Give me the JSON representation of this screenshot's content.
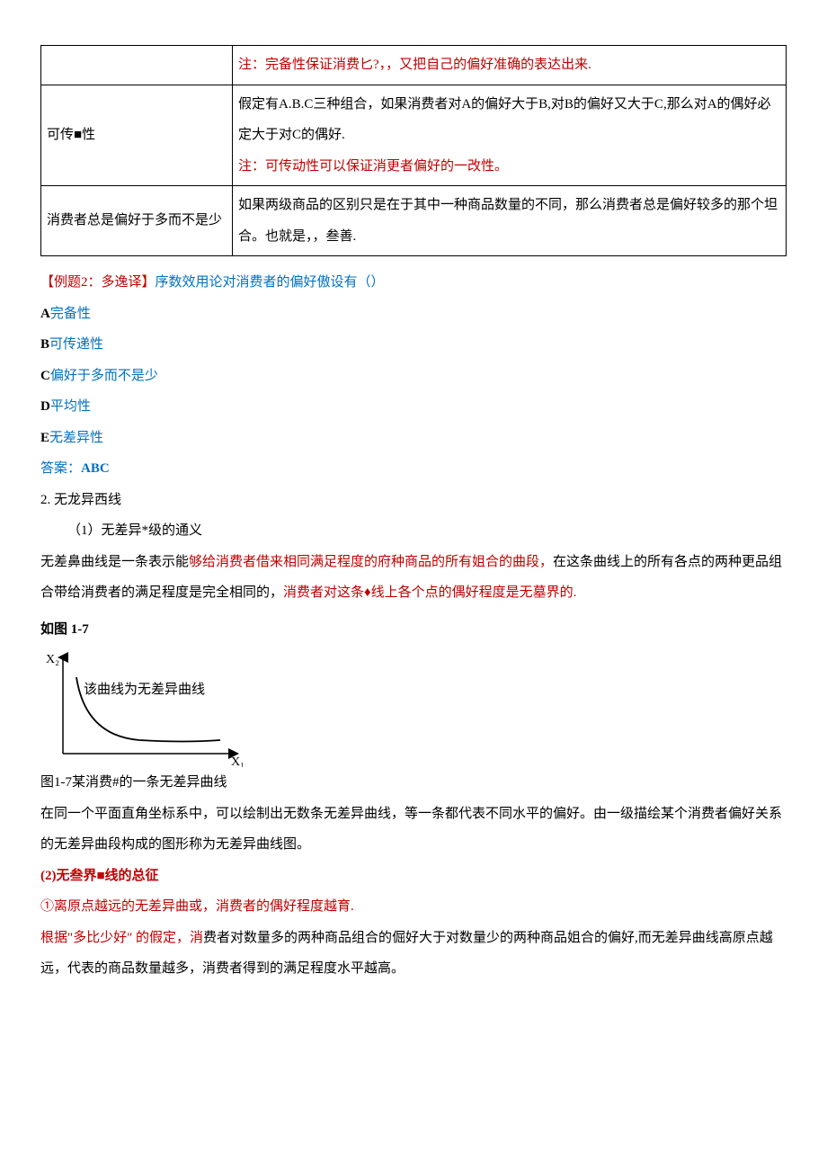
{
  "table": {
    "r0_note_prefix": "注：完备性",
    "r0_note_rest": "保证消费匕?，，又把自己的偏好准确的表达出来.",
    "r1_label": "可传■性",
    "r1_body1": "假定有A.B.C三种组合，如果消费者对A的偏好大于B,对B的偏好又大于C,那么对A的偶好必定大于对C的偶好.",
    "r1_note_prefix": "注：",
    "r1_note_rest": "可传动性可以保证消更者偏好的一改性。",
    "r2_label": "消费者总是偏好于多而不是少",
    "r2_body": "如果两级商品的区别只是在于其中一种商品数量的不同，那么消费者总是偏好较多的那个坦合。也就是，，叁善."
  },
  "question": {
    "tag": "【例题2：多逸译】",
    "stem": "序数效用论对消费者的偏好傲设有（）",
    "A_letter": "A",
    "A_text": "完备性",
    "B_letter": "B",
    "B_text": "可传递性",
    "C_letter": "C",
    "C_text": "偏好于多而不是少",
    "D_letter": "D",
    "D_text": "平均性",
    "E_letter": "E",
    "E_text": "无差异性",
    "ans_label": "答案：",
    "ans_value": "ABC"
  },
  "section": {
    "s2_title": "2. 无龙异西线",
    "s2_1_title": "（1）无差异*级的通义",
    "s2_1_body_pre": "无差鼻曲线是一条表示能",
    "s2_1_body_red": "够给消费者借来相同满足程度的府种商品的所有姐合的曲段，",
    "s2_1_body_post1": "在这条曲线上的所有各点的两种更品组合带给消费者的满足程度是完全相同的，",
    "s2_1_body_red2": "消费者对这条♦线上各个点的偶好程度是无墓界的.",
    "fig_label": "如图 1-7",
    "fig_caption": "图1-7某消费#的一条无差异曲线",
    "fig_text_inside": "该曲线为无差异曲线",
    "axis_y": "X₂",
    "axis_x": "X₁",
    "s2_1_body2": "在同一个平面直角坐标系中，可以绘制出无数条无差异曲线，等一条都代表不同水平的偏好。由一级描绘某个消费者偏好关系的无差异曲段构成的图形称为无差异曲线图。",
    "s2_2_title": "(2)无叁界■线的总征",
    "s2_2_p1": "①离原点越远的无差异曲或，消费者的偶好程度越育.",
    "s2_2_p2_red": "根据\"多比少好\" 的假定，消",
    "s2_2_p2_rest": "费者对数量多的两种商品组合的倔好大于对数量少的两种商品姐合的偏好,而无差异曲线高原点越远，代表的商品数量越多，消费者得到的满足程度水平越高。"
  }
}
